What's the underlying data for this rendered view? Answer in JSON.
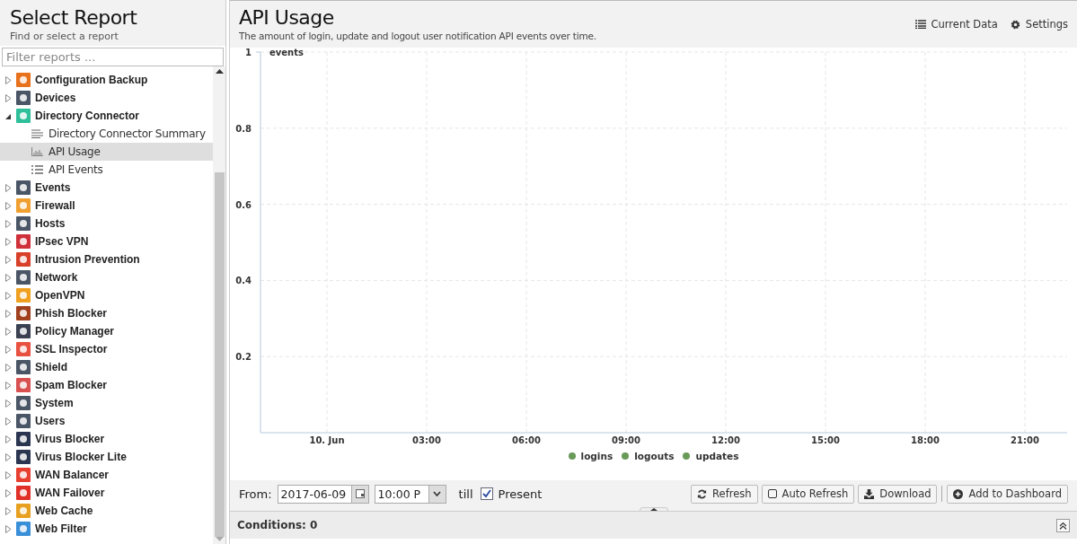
{
  "sidebar": {
    "title": "Select Report",
    "subtitle": "Find or select a report",
    "filter": {
      "placeholder": "Filter reports ..."
    },
    "items": [
      {
        "label": "Configuration Backup",
        "color": "#e8711c",
        "expanded": false,
        "selected": false
      },
      {
        "label": "Devices",
        "color": "#4a5566",
        "expanded": false,
        "selected": false
      },
      {
        "label": "Directory Connector",
        "color": "#2fbf9a",
        "expanded": true,
        "selected": false,
        "children": [
          {
            "label": "Directory Connector Summary",
            "kind": "summary",
            "selected": false
          },
          {
            "label": "API Usage",
            "kind": "chart",
            "selected": true
          },
          {
            "label": "API Events",
            "kind": "list",
            "selected": false
          }
        ]
      },
      {
        "label": "Events",
        "color": "#4a5566",
        "expanded": false,
        "selected": false
      },
      {
        "label": "Firewall",
        "color": "#f0a030",
        "expanded": false,
        "selected": false
      },
      {
        "label": "Hosts",
        "color": "#4a5566",
        "expanded": false,
        "selected": false
      },
      {
        "label": "IPsec VPN",
        "color": "#d0303a",
        "expanded": false,
        "selected": false
      },
      {
        "label": "Intrusion Prevention",
        "color": "#d8402a",
        "expanded": false,
        "selected": false
      },
      {
        "label": "Network",
        "color": "#4a5566",
        "expanded": false,
        "selected": false
      },
      {
        "label": "OpenVPN",
        "color": "#f0a020",
        "expanded": false,
        "selected": false
      },
      {
        "label": "Phish Blocker",
        "color": "#a0401c",
        "expanded": false,
        "selected": false
      },
      {
        "label": "Policy Manager",
        "color": "#3a4050",
        "expanded": false,
        "selected": false
      },
      {
        "label": "SSL Inspector",
        "color": "#e85040",
        "expanded": false,
        "selected": false
      },
      {
        "label": "Shield",
        "color": "#4a5566",
        "expanded": false,
        "selected": false
      },
      {
        "label": "Spam Blocker",
        "color": "#d85050",
        "expanded": false,
        "selected": false
      },
      {
        "label": "System",
        "color": "#4a5566",
        "expanded": false,
        "selected": false
      },
      {
        "label": "Users",
        "color": "#4a5566",
        "expanded": false,
        "selected": false
      },
      {
        "label": "Virus Blocker",
        "color": "#2a3550",
        "expanded": false,
        "selected": false
      },
      {
        "label": "Virus Blocker Lite",
        "color": "#2a3550",
        "expanded": false,
        "selected": false
      },
      {
        "label": "WAN Balancer",
        "color": "#e84030",
        "expanded": false,
        "selected": false
      },
      {
        "label": "WAN Failover",
        "color": "#e03028",
        "expanded": false,
        "selected": false
      },
      {
        "label": "Web Cache",
        "color": "#e8a020",
        "expanded": false,
        "selected": false
      },
      {
        "label": "Web Filter",
        "color": "#3a90d8",
        "expanded": false,
        "selected": false
      }
    ]
  },
  "report": {
    "title": "API Usage",
    "description": "The amount of login, update and logout user notification API events over time.",
    "actions": [
      {
        "label": "Current Data",
        "kind": "data"
      },
      {
        "label": "Settings",
        "kind": "settings"
      }
    ],
    "chart_data": {
      "type": "line",
      "ylabel": "events",
      "ylim": [
        0,
        1
      ],
      "grid": true,
      "categories": [
        "10. Jun",
        "03:00",
        "06:00",
        "09:00",
        "12:00",
        "15:00",
        "18:00",
        "21:00"
      ],
      "yticks": [
        0.2,
        0.4,
        0.6,
        0.8,
        1
      ],
      "series": [
        {
          "name": "logins",
          "color": "#6a9a5a",
          "values": [
            null,
            null,
            null,
            null,
            null,
            null,
            null,
            null
          ]
        },
        {
          "name": "logouts",
          "color": "#6a9a5a",
          "values": [
            null,
            null,
            null,
            null,
            null,
            null,
            null,
            null
          ]
        },
        {
          "name": "updates",
          "color": "#6a9a5a",
          "values": [
            null,
            null,
            null,
            null,
            null,
            null,
            null,
            null
          ]
        }
      ]
    }
  },
  "toolbar": {
    "from_label": "From:",
    "date": "2017-06-09",
    "time": "10:00 P",
    "till_label": "till",
    "present": {
      "label": "Present",
      "checked": true
    },
    "buttons": [
      {
        "label": "Refresh",
        "kind": "refresh"
      },
      {
        "label": "Auto Refresh",
        "kind": "toggle"
      },
      {
        "label": "Download",
        "kind": "download"
      },
      {
        "label": "Add to Dashboard",
        "kind": "add"
      }
    ]
  },
  "conditions": {
    "label": "Conditions: 0"
  }
}
